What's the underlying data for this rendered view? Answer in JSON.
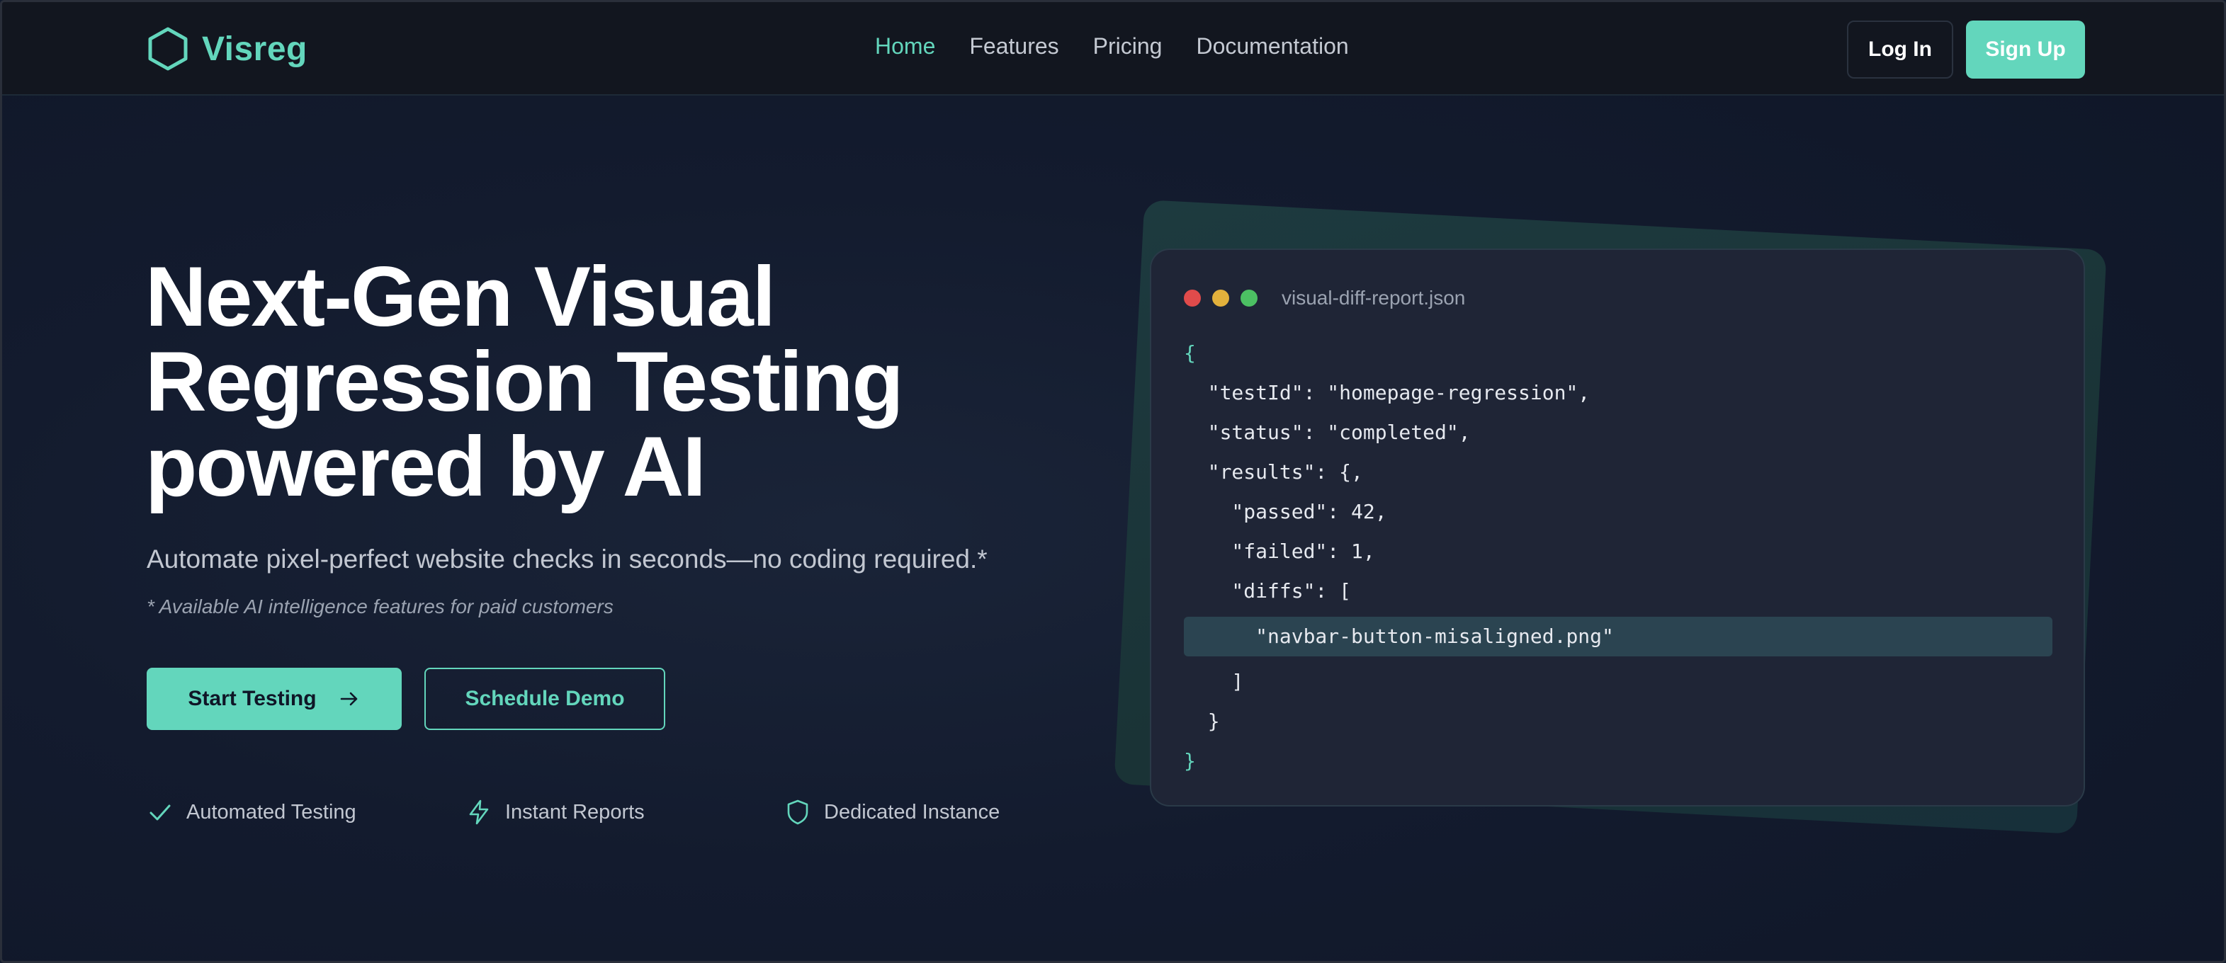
{
  "brand": {
    "name": "Visreg",
    "accent_color": "#63d6bc",
    "logo_icon": "hexagon-icon"
  },
  "nav": {
    "links": [
      "Home",
      "Features",
      "Pricing",
      "Documentation"
    ],
    "active": "Home",
    "login_label": "Log In",
    "signup_label": "Sign Up"
  },
  "hero": {
    "title_lines": [
      "Next-Gen Visual",
      "Regression Testing",
      "powered by AI"
    ],
    "subtitle": "Automate pixel-perfect website checks in seconds—no coding required.*",
    "note": "* Available AI intelligence features for paid customers",
    "primary_cta": "Start Testing",
    "primary_cta_icon": "arrow-right-icon",
    "secondary_cta": "Schedule Demo",
    "features": [
      {
        "label": "Automated Testing",
        "icon": "check-icon"
      },
      {
        "label": "Instant Reports",
        "icon": "lightning-icon"
      },
      {
        "label": "Dedicated Instance",
        "icon": "shield-icon"
      }
    ]
  },
  "code_window": {
    "filename": "visual-diff-report.json",
    "lines": [
      "{",
      "  \"testId\": \"homepage-regression\",",
      "  \"status\": \"completed\",",
      "  \"results\": {,",
      "    \"passed\": 42,",
      "    \"failed\": 1,",
      "    \"diffs\": [",
      "      \"navbar-button-misaligned.png\"",
      "    ]",
      "  }",
      "}"
    ],
    "highlighted_line": 7
  }
}
